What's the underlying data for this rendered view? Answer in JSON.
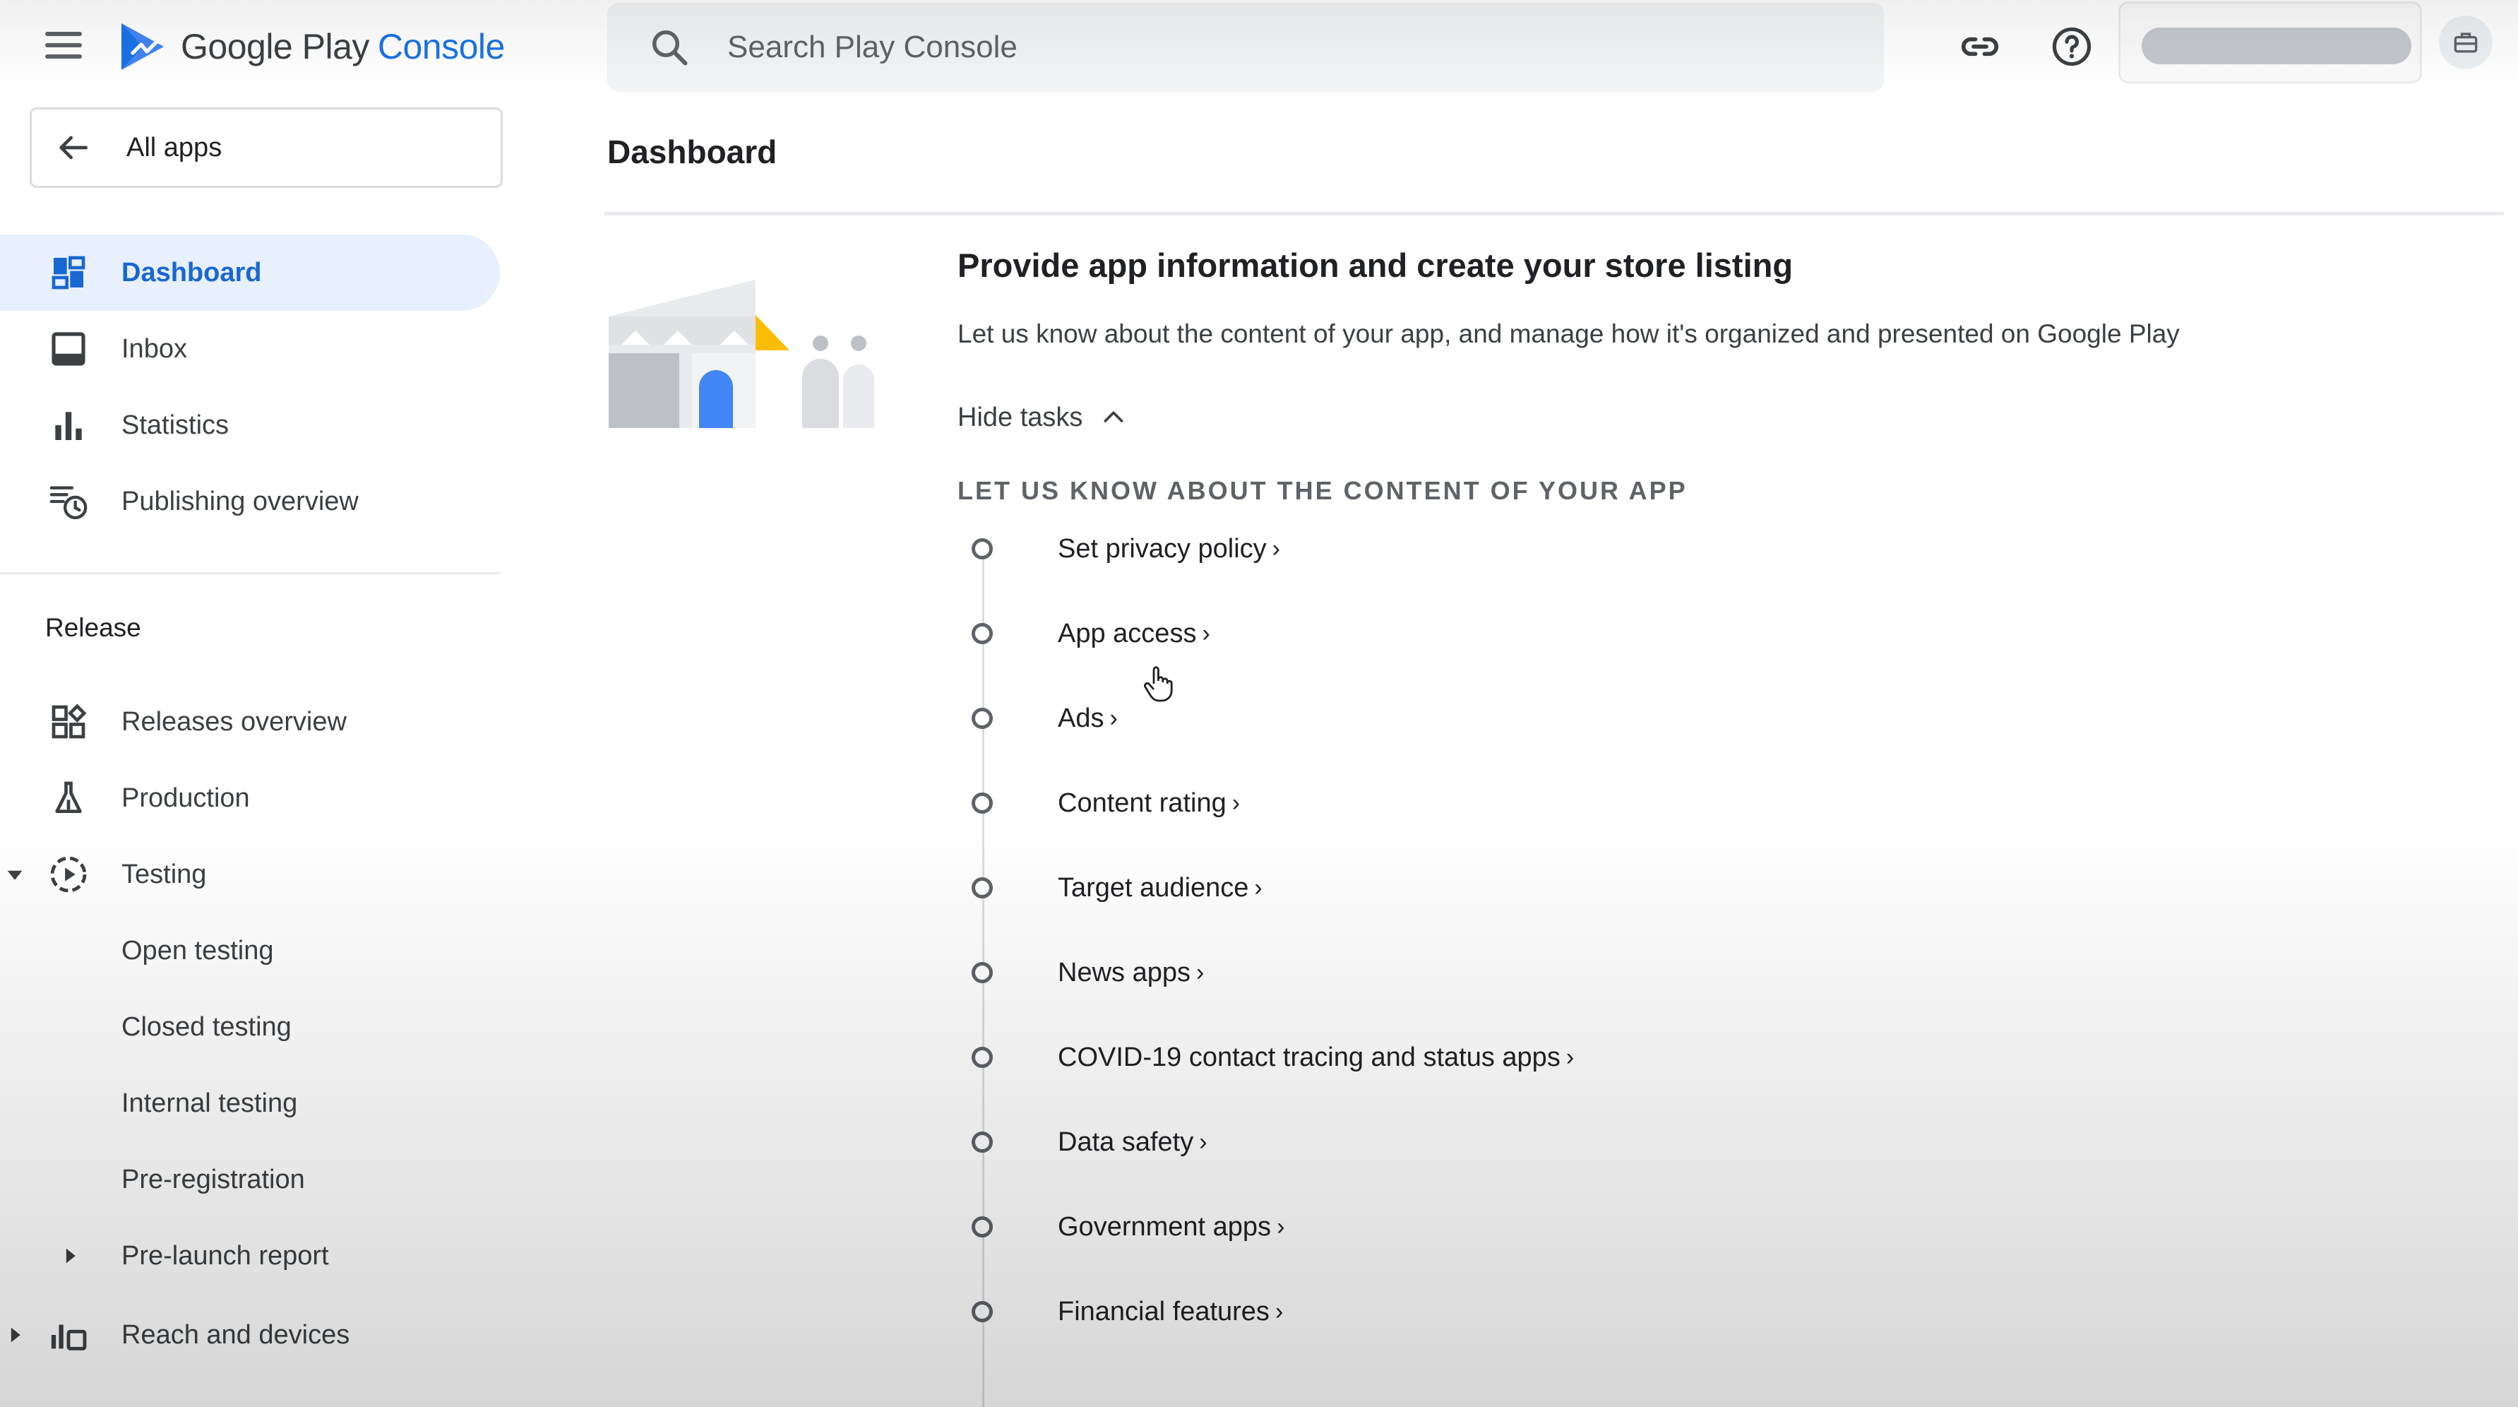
{
  "app": {
    "logo_google": "Google Play",
    "logo_console": "Console",
    "brand_color": "#1a73e8"
  },
  "search": {
    "placeholder": "Search Play Console",
    "value": ""
  },
  "toolbar": {
    "link_icon": "link-icon",
    "help_icon": "help-icon",
    "account_icon": "briefcase-icon"
  },
  "sidebar": {
    "all_apps": "All apps",
    "main_items": [
      {
        "label": "Dashboard",
        "icon": "dashboard-icon",
        "active": true
      },
      {
        "label": "Inbox",
        "icon": "inbox-icon"
      },
      {
        "label": "Statistics",
        "icon": "bar-chart-icon"
      },
      {
        "label": "Publishing overview",
        "icon": "publishing-clock-icon"
      }
    ],
    "release_title": "Release",
    "release_items": [
      {
        "label": "Releases overview",
        "icon": "releases-grid-icon"
      },
      {
        "label": "Production",
        "icon": "flask-icon"
      },
      {
        "label": "Testing",
        "icon": "play-circle-icon",
        "expanded": true
      }
    ],
    "testing_children": [
      "Open testing",
      "Closed testing",
      "Internal testing",
      "Pre-registration",
      "Pre-launch report"
    ],
    "reach_devices": "Reach and devices"
  },
  "main": {
    "page_title": "Dashboard",
    "card": {
      "title": "Provide app information and create your store listing",
      "description": "Let us know about the content of your app, and manage how it's organized and presented on Google Play",
      "hide_tasks": "Hide tasks",
      "section_heading": "LET US KNOW ABOUT THE CONTENT OF YOUR APP",
      "tasks": [
        "Set privacy policy",
        "App access",
        "Ads",
        "Content rating",
        "Target audience",
        "News apps",
        "COVID-19 contact tracing and status apps",
        "Data safety",
        "Government apps",
        "Financial features"
      ]
    }
  }
}
